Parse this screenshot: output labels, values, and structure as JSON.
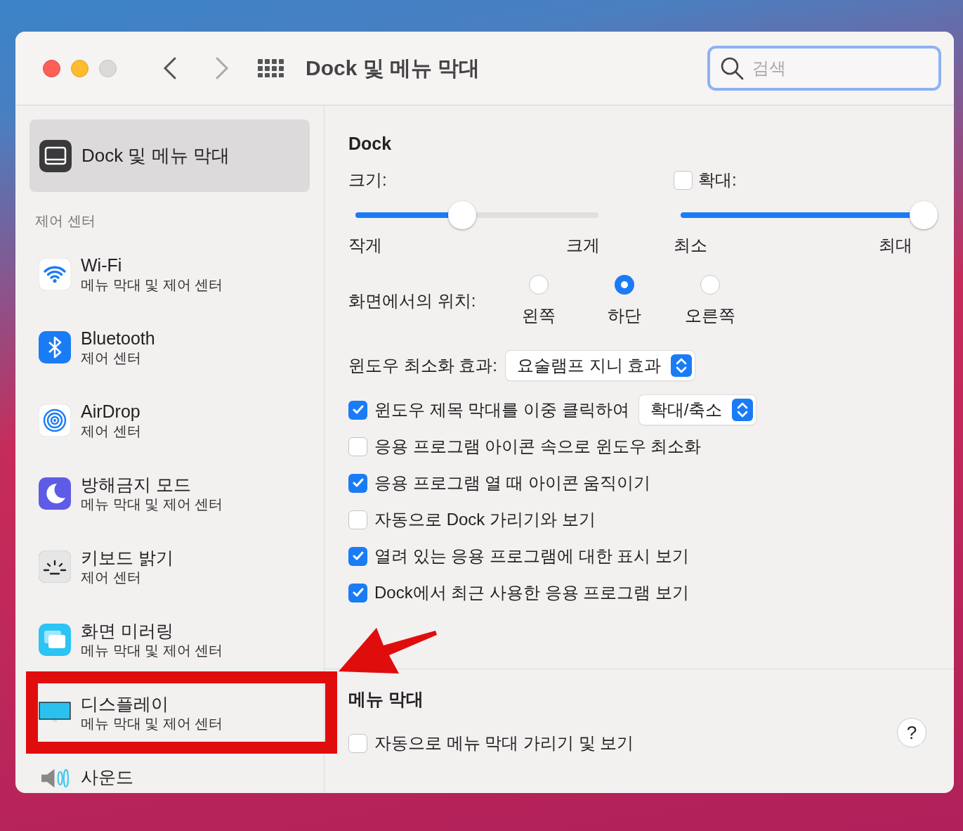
{
  "window": {
    "title": "Dock 및 메뉴 막대",
    "search": {
      "placeholder": "검색"
    }
  },
  "sidebar": {
    "top_item": {
      "label": "Dock 및 메뉴 막대",
      "kind": "dock",
      "selected": true
    },
    "section_title": "제어 센터",
    "items": [
      {
        "label": "Wi-Fi",
        "sublabel": "메뉴 막대 및 제어 센터",
        "kind": "wifi",
        "selected": false
      },
      {
        "label": "Bluetooth",
        "sublabel": "제어 센터",
        "kind": "bluetooth",
        "selected": false
      },
      {
        "label": "AirDrop",
        "sublabel": "제어 센터",
        "kind": "airdrop",
        "selected": false
      },
      {
        "label": "방해금지 모드",
        "sublabel": "메뉴 막대 및 제어 센터",
        "kind": "moon",
        "selected": false
      },
      {
        "label": "키보드 밝기",
        "sublabel": "제어 센터",
        "kind": "brightness",
        "selected": false
      },
      {
        "label": "화면 미러링",
        "sublabel": "메뉴 막대 및 제어 센터",
        "kind": "mirroring",
        "selected": false
      },
      {
        "label": "디스플레이",
        "sublabel": "메뉴 막대 및 제어 센터",
        "kind": "display",
        "selected": false
      },
      {
        "label": "사운드",
        "kind": "sound",
        "selected": false
      }
    ]
  },
  "dock": {
    "title": "Dock",
    "size": {
      "label": "크기:",
      "level": 0.44,
      "min_label": "작게",
      "max_label": "크게"
    },
    "magnification": {
      "label": "확대:",
      "checked": false,
      "level": 1.0,
      "min_label": "최소",
      "max_label": "최대"
    },
    "position": {
      "label": "화면에서의 위치:",
      "options": [
        {
          "label": "왼쪽",
          "selected": false
        },
        {
          "label": "하단",
          "selected": true
        },
        {
          "label": "오른쪽",
          "selected": false
        }
      ]
    },
    "minimize_effect": {
      "label": "윈도우 최소화 효과:",
      "value": "요술램프 지니 효과"
    },
    "options": [
      {
        "label": "윈도우 제목 막대를 이중 클릭하여",
        "checked": true,
        "dropdown": "확대/축소"
      },
      {
        "label": "응용 프로그램 아이콘 속으로 윈도우 최소화",
        "checked": false
      },
      {
        "label": "응용 프로그램 열 때 아이콘 움직이기",
        "checked": true
      },
      {
        "label": "자동으로 Dock 가리기와 보기",
        "checked": false
      },
      {
        "label": "열려 있는 응용 프로그램에 대한 표시 보기",
        "checked": true
      },
      {
        "label": "Dock에서 최근 사용한 응용 프로그램 보기",
        "checked": true
      }
    ]
  },
  "menu_bar": {
    "title": "메뉴 막대",
    "options": [
      {
        "label": "자동으로 메뉴 막대 가리기 및 보기",
        "checked": false
      }
    ],
    "help": "?"
  }
}
